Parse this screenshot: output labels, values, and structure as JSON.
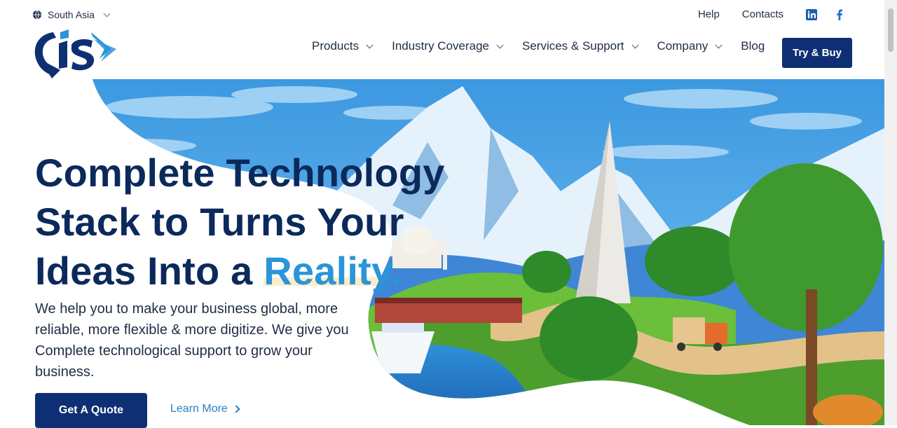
{
  "topbar": {
    "region_label": "South Asia",
    "help_label": "Help",
    "contacts_label": "Contacts",
    "social": [
      "linkedin-icon",
      "facebook-icon"
    ]
  },
  "logo": {
    "text": "CIS",
    "colors": {
      "primary": "#0e2f73",
      "secondary": "#2a95d8"
    }
  },
  "nav": {
    "items": [
      {
        "label": "Products"
      },
      {
        "label": "Industry Coverage"
      },
      {
        "label": "Services & Support"
      },
      {
        "label": "Company"
      },
      {
        "label": "Blog"
      }
    ],
    "cta_label": "Try & Buy"
  },
  "hero": {
    "headline_line1": "Complete Technology",
    "headline_line2": "Stack to Turns Your",
    "headline_line3_prefix": "Ideas Into a ",
    "headline_accent": "Reality",
    "headline_accent_dot": ".",
    "subtext": "We help you to make your business global, more reliable, more flexible & more digitize. We give you Complete technological support to grow your business.",
    "primary_button": "Get A Quote",
    "secondary_link": "Learn More"
  },
  "colors": {
    "brand": "#0e2f73",
    "accent": "#2a95d8",
    "text": "#1f2d44",
    "sky": "#3d9be2"
  }
}
